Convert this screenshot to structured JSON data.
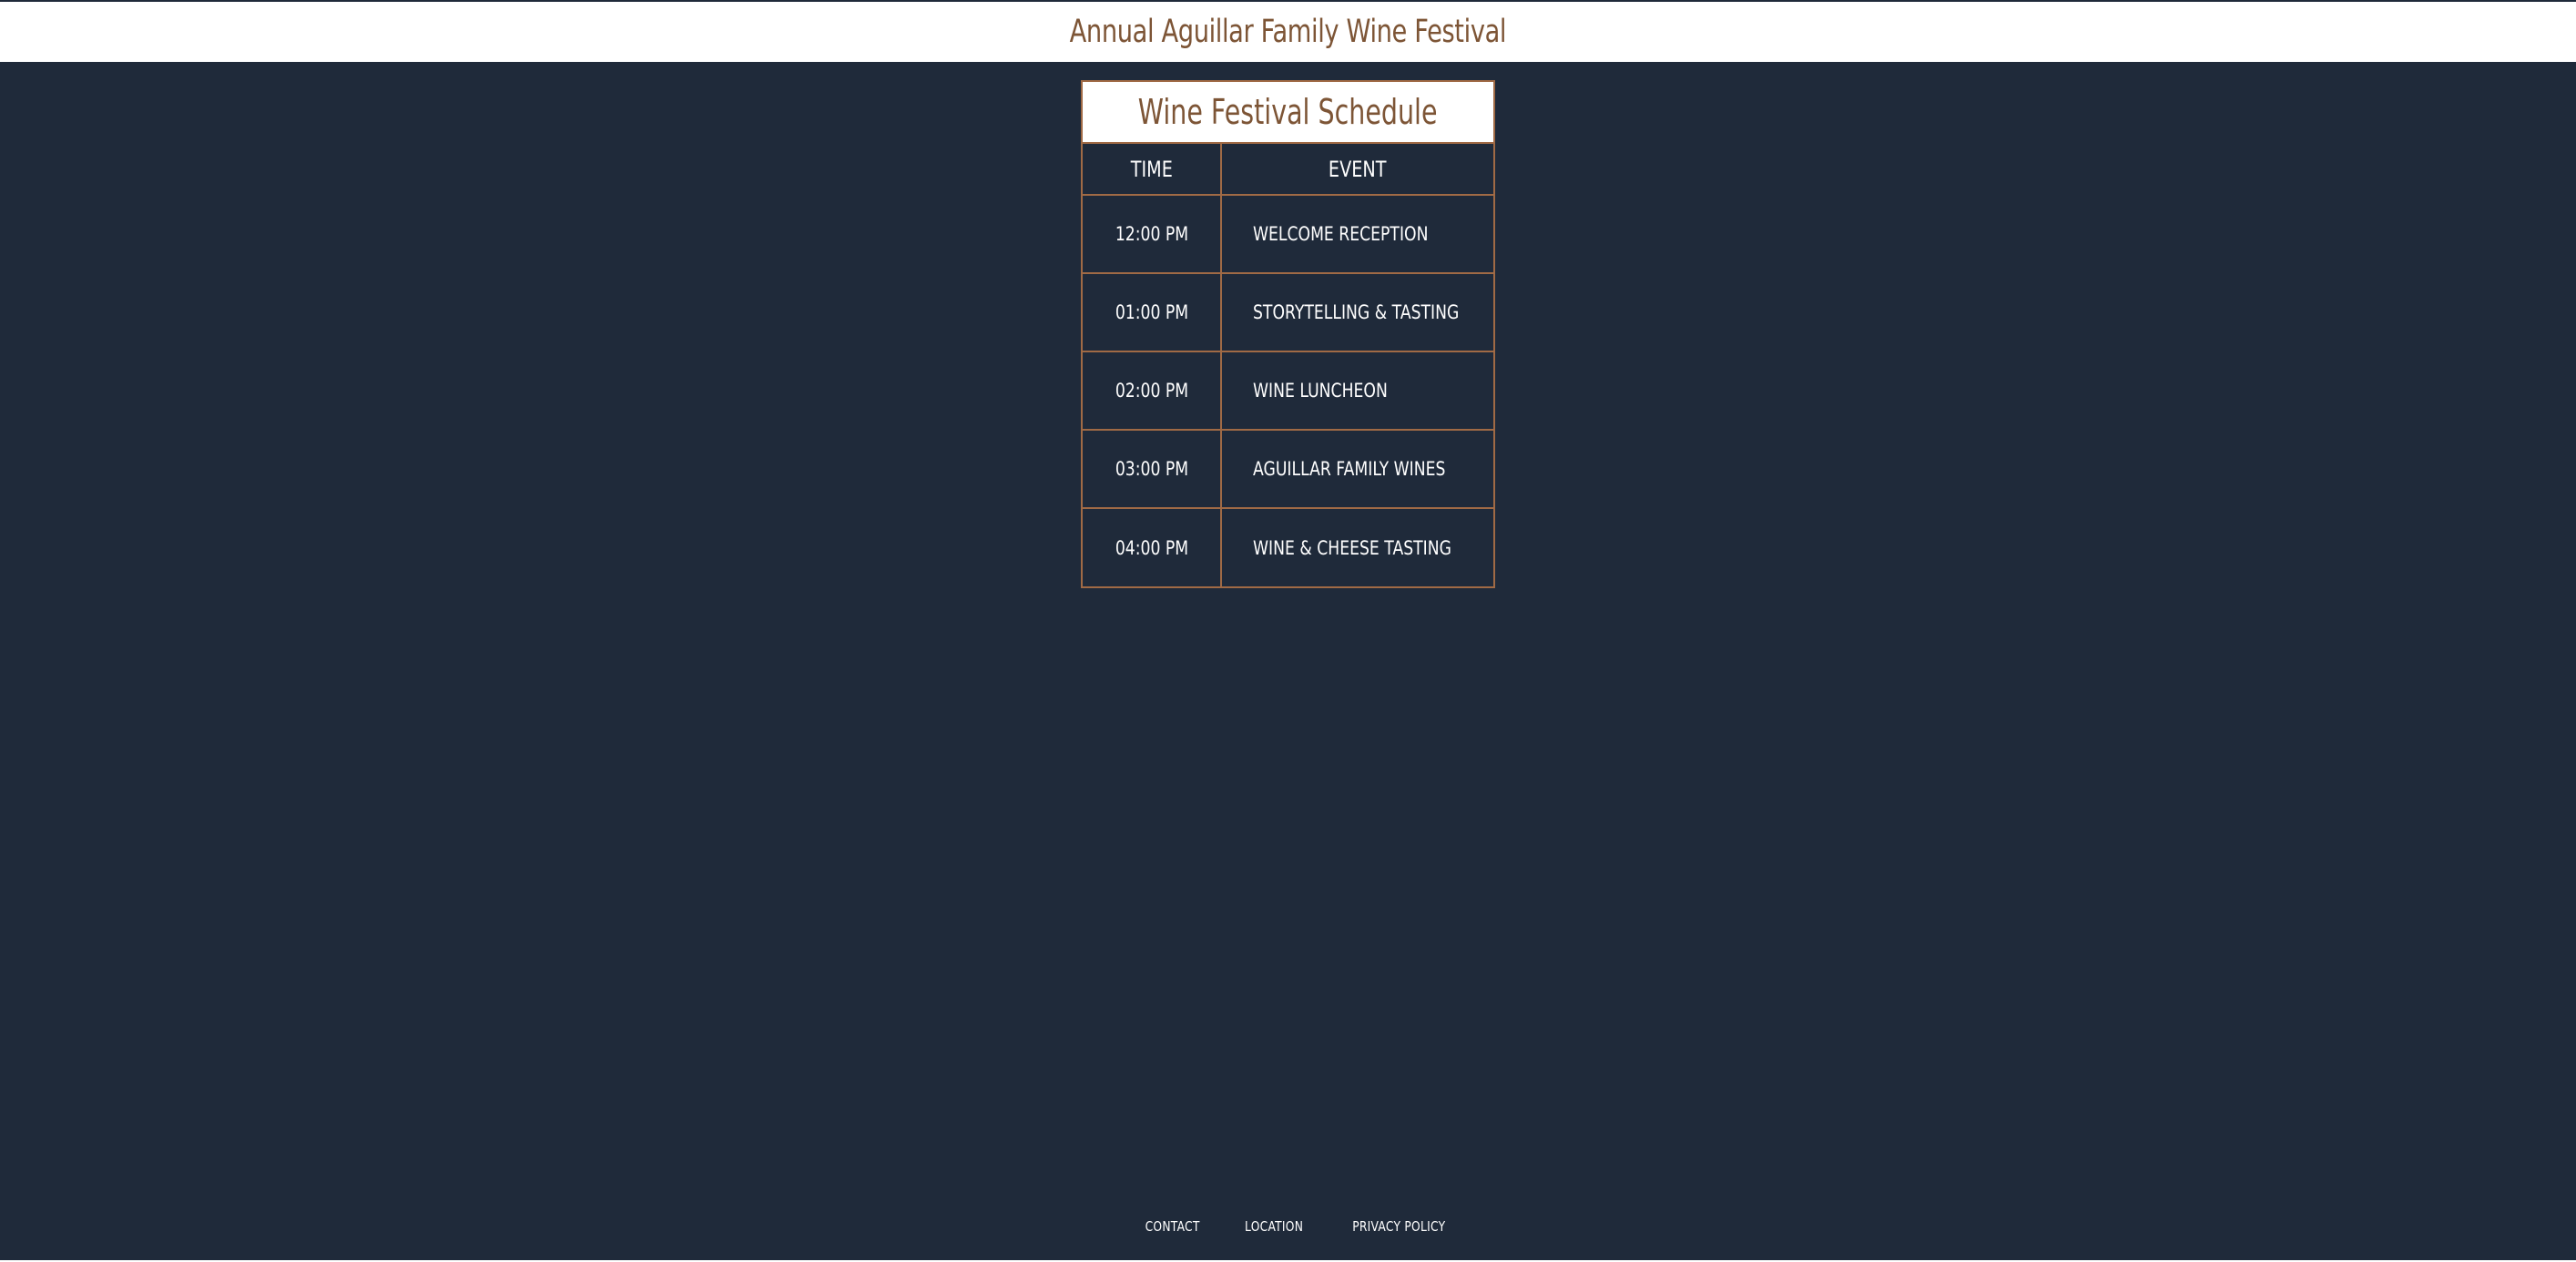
{
  "colors": {
    "page_background": "#1f2a3a",
    "accent_brown": "#7d5536",
    "table_border": "#a06a45",
    "text_light": "#ffffff"
  },
  "header": {
    "title": "Annual Aguillar Family Wine Festival"
  },
  "schedule": {
    "title": "Wine Festival Schedule",
    "columns": {
      "time": "TIME",
      "event": "EVENT"
    },
    "rows": [
      {
        "time": "12:00 PM",
        "event": "WELCOME RECEPTION"
      },
      {
        "time": "01:00 PM",
        "event": "STORYTELLING & TASTING"
      },
      {
        "time": "02:00 PM",
        "event": "WINE LUNCHEON"
      },
      {
        "time": "03:00 PM",
        "event": "AGUILLAR FAMILY WINES"
      },
      {
        "time": "04:00 PM",
        "event": "WINE & CHEESE TASTING"
      }
    ]
  },
  "footer": {
    "links": [
      {
        "label": "CONTACT"
      },
      {
        "label": "LOCATION"
      },
      {
        "label": "PRIVACY POLICY"
      }
    ]
  }
}
